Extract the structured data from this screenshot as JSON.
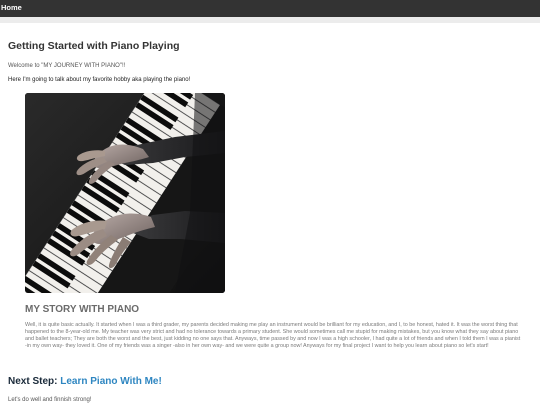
{
  "nav": {
    "home_label": "Home"
  },
  "page": {
    "title": "Getting Started with Piano Playing",
    "welcome": "Welcome to \"MY JOURNEY WITH PIANO\"!!",
    "intro": "Here I'm going to talk about my favorite hobby aka playing the piano!"
  },
  "photo": {
    "subject": "hands playing a piano keyboard"
  },
  "story": {
    "heading": "MY STORY WITH PIANO",
    "body": "Well, it is quite basic actually. It started when I was a third grader, my parents decided making me play an instrument would be brilliant for my education, and I, to be honest, hated it. It was the worst thing that happened to the 8-year-old me. My teacher was very strict and had no tolerance towards a primary student. She would sometimes call me stupid for making mistakes, but you know what they say about piano and ballet teachers; They are both the worst and the best, just kidding no one says that. Anyways, time passed by and now I was a high schooler, I had quite a lot of friends and when I told them I was a pianist -in my own way- they loved it. One of my friends was a singer -also in her own way- and we were quite a group now! Anyways for my final project I want to help you learn about piano so let's start!"
  },
  "next": {
    "prefix": "Next Step:",
    "link_label": "Learn Piano With Me!",
    "closing": "Let's do well and finnish strong!"
  },
  "colors": {
    "topbar": "#333333",
    "link": "#2e86c1",
    "heading_gray": "#6b6b6b"
  }
}
